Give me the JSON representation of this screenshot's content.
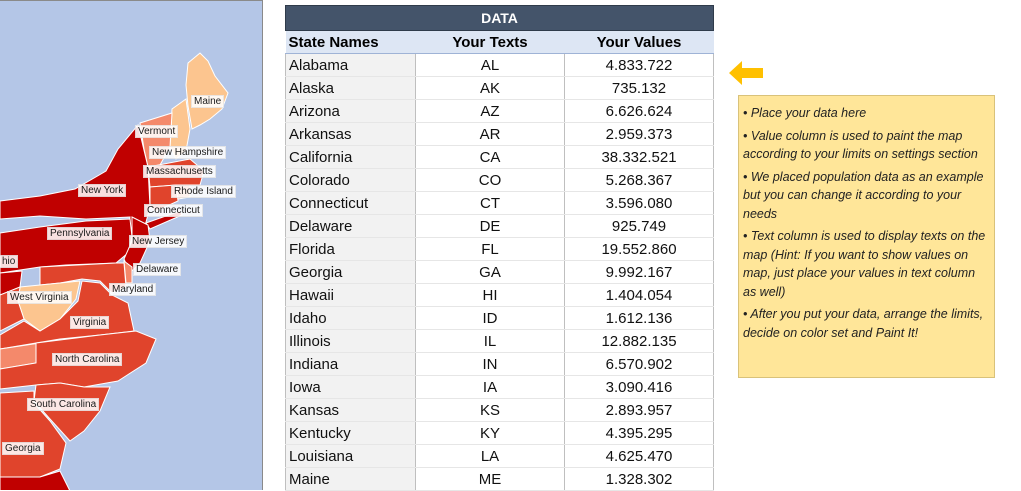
{
  "map": {
    "labels": [
      "Maine",
      "Vermont",
      "New Hampshire",
      "Massachusetts",
      "New York",
      "Rhode Island",
      "Connecticut",
      "Pennsylvania",
      "New Jersey",
      "hio",
      "Delaware",
      "Maryland",
      "West Virginia",
      "Virginia",
      "North Carolina",
      "South Carolina",
      "Georgia"
    ],
    "colors": {
      "ocean": "#b4c6e7",
      "dark": "#c00000",
      "mid": "#e0442c",
      "light": "#f4896b",
      "pale": "#fcc58f"
    }
  },
  "table": {
    "title": "DATA",
    "headers": [
      "State Names",
      "Your Texts",
      "Your Values"
    ],
    "rows": [
      [
        "Alabama",
        "AL",
        "4.833.722"
      ],
      [
        "Alaska",
        "AK",
        "735.132"
      ],
      [
        "Arizona",
        "AZ",
        "6.626.624"
      ],
      [
        "Arkansas",
        "AR",
        "2.959.373"
      ],
      [
        "California",
        "CA",
        "38.332.521"
      ],
      [
        "Colorado",
        "CO",
        "5.268.367"
      ],
      [
        "Connecticut",
        "CT",
        "3.596.080"
      ],
      [
        "Delaware",
        "DE",
        "925.749"
      ],
      [
        "Florida",
        "FL",
        "19.552.860"
      ],
      [
        "Georgia",
        "GA",
        "9.992.167"
      ],
      [
        "Hawaii",
        "HI",
        "1.404.054"
      ],
      [
        "Idaho",
        "ID",
        "1.612.136"
      ],
      [
        "Illinois",
        "IL",
        "12.882.135"
      ],
      [
        "Indiana",
        "IN",
        "6.570.902"
      ],
      [
        "Iowa",
        "IA",
        "3.090.416"
      ],
      [
        "Kansas",
        "KS",
        "2.893.957"
      ],
      [
        "Kentucky",
        "KY",
        "4.395.295"
      ],
      [
        "Louisiana",
        "LA",
        "4.625.470"
      ],
      [
        "Maine",
        "ME",
        "1.328.302"
      ]
    ]
  },
  "notes": [
    "• Place your data here",
    "• Value column is used to paint the map according to your limits on settings section",
    "• We placed population data as an example but you can change it according to your needs",
    "• Text column is used to display texts on the map (Hint: If you want to show values on map, just place your values in text column as well)",
    "• After you put your data, arrange the limits, decide on color set and Paint It!"
  ],
  "arrow_icon": "arrow-left-icon",
  "accent_color": "#ffc000"
}
